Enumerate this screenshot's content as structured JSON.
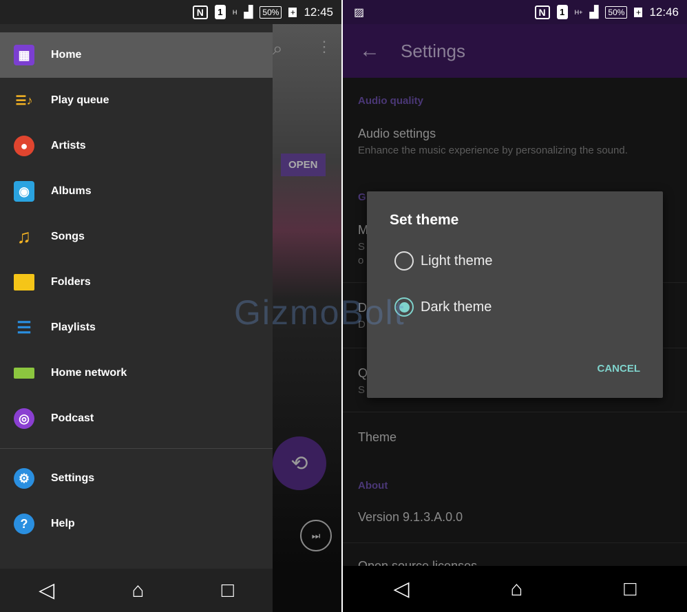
{
  "left": {
    "status": {
      "time": "12:45",
      "battery": "50%",
      "sim": "1",
      "network": "H"
    },
    "behind": {
      "open_label": "OPEN"
    },
    "drawer": {
      "items": [
        {
          "label": "Home",
          "icon": "home-icon",
          "color": "#7b3fd1"
        },
        {
          "label": "Play queue",
          "icon": "play-queue-icon",
          "color": "#f5b323"
        },
        {
          "label": "Artists",
          "icon": "artist-icon",
          "color": "#e0452f"
        },
        {
          "label": "Albums",
          "icon": "album-icon",
          "color": "#2aa3e0"
        },
        {
          "label": "Songs",
          "icon": "music-note-icon",
          "color": "#f5b323"
        },
        {
          "label": "Folders",
          "icon": "folder-icon",
          "color": "#f5c518"
        },
        {
          "label": "Playlists",
          "icon": "playlist-icon",
          "color": "#2a8fe0"
        },
        {
          "label": "Home network",
          "icon": "home-network-icon",
          "color": "#8cc63f"
        },
        {
          "label": "Podcast",
          "icon": "podcast-icon",
          "color": "#8a3fd1"
        }
      ],
      "footer": [
        {
          "label": "Settings",
          "icon": "gear-icon",
          "color": "#2a8fe0"
        },
        {
          "label": "Help",
          "icon": "help-icon",
          "color": "#2a8fe0"
        }
      ]
    }
  },
  "right": {
    "status": {
      "time": "12:46",
      "battery": "50%",
      "sim": "1",
      "network": "H+"
    },
    "toolbar": {
      "title": "Settings"
    },
    "settings": {
      "audio_quality_header": "Audio quality",
      "audio_settings": "Audio settings",
      "audio_settings_sub": "Enhance the music experience by personalizing the sound.",
      "general_header_partial": "G",
      "obscured": [
        "M",
        "S",
        "o",
        "D",
        "D",
        "Q",
        "S"
      ],
      "theme": "Theme",
      "about_header": "About",
      "version": "Version 9.1.3.A.0.0",
      "open_source": "Open source licenses"
    },
    "dialog": {
      "title": "Set theme",
      "options": [
        {
          "label": "Light theme",
          "selected": false
        },
        {
          "label": "Dark theme",
          "selected": true
        }
      ],
      "cancel": "CANCEL"
    }
  },
  "watermark": "GizmoBolt"
}
